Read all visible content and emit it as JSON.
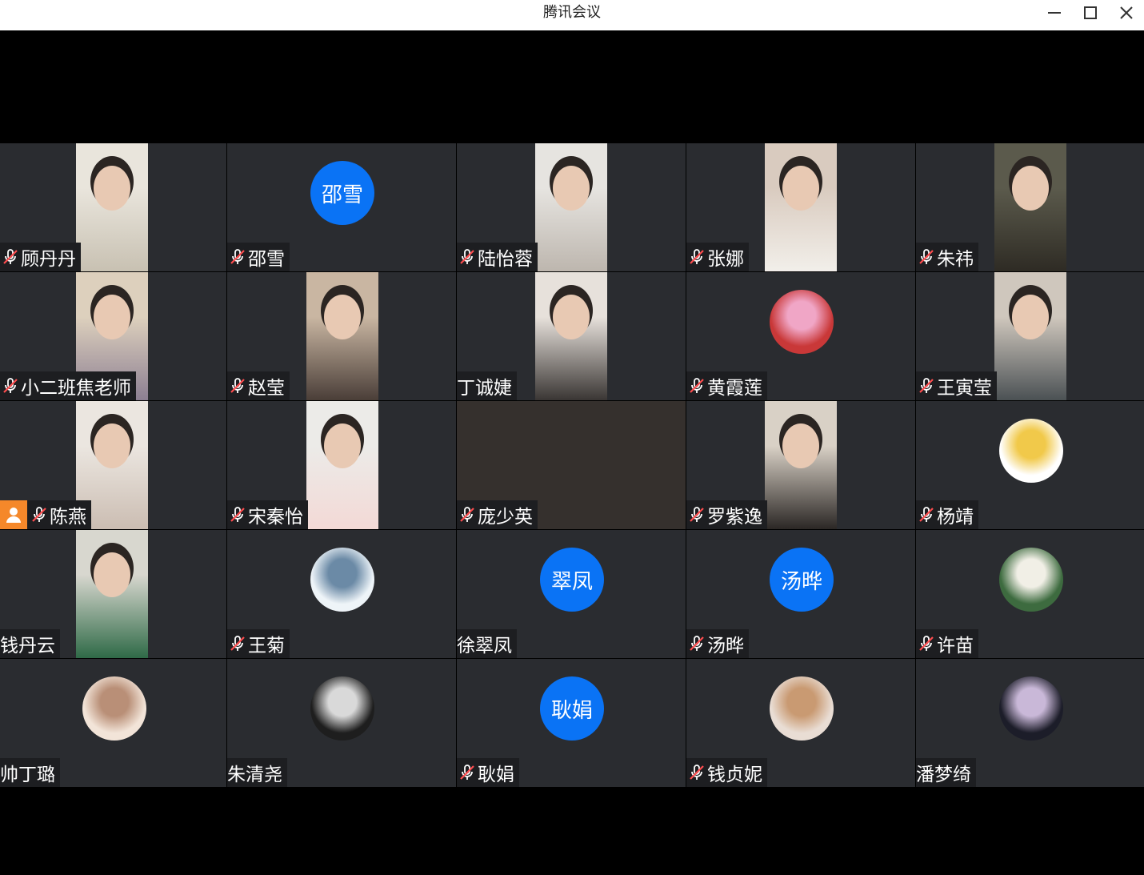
{
  "window": {
    "title": "腾讯会议"
  },
  "participants": [
    {
      "name": "顾丹丹",
      "muted": true,
      "media": "video",
      "colors": [
        "#e9e5dc",
        "#c8c1b2"
      ]
    },
    {
      "name": "邵雪",
      "muted": true,
      "media": "initials",
      "initials": "邵雪"
    },
    {
      "name": "陆怡蓉",
      "muted": true,
      "media": "video",
      "colors": [
        "#e6e4e0",
        "#bdb6ae"
      ]
    },
    {
      "name": "张娜",
      "muted": true,
      "media": "video",
      "colors": [
        "#d9cbbf",
        "#f2efea"
      ]
    },
    {
      "name": "朱祎",
      "muted": true,
      "media": "video",
      "colors": [
        "#5b5a4c",
        "#2e2b24"
      ]
    },
    {
      "name": "小二班焦老师",
      "muted": true,
      "media": "video",
      "colors": [
        "#ddd0bd",
        "#8c7f92"
      ]
    },
    {
      "name": "赵莹",
      "muted": true,
      "media": "video",
      "colors": [
        "#c9b6a2",
        "#4a3e38"
      ]
    },
    {
      "name": "丁诚婕",
      "muted": false,
      "media": "video",
      "colors": [
        "#e7e1db",
        "#3a3634"
      ]
    },
    {
      "name": "黄霞莲",
      "muted": true,
      "media": "avatar",
      "colors": [
        "#c93838",
        "#f0a6c6"
      ]
    },
    {
      "name": "王寅莹",
      "muted": true,
      "media": "video",
      "colors": [
        "#cfc7bd",
        "#4b5154"
      ]
    },
    {
      "name": "陈燕",
      "muted": true,
      "host": true,
      "media": "video",
      "colors": [
        "#ebe6e0",
        "#cbbdb2"
      ]
    },
    {
      "name": "宋秦怡",
      "muted": true,
      "media": "video",
      "colors": [
        "#ecebe8",
        "#f3d9d6"
      ]
    },
    {
      "name": "庞少英",
      "muted": true,
      "media": "none"
    },
    {
      "name": "罗紫逸",
      "muted": true,
      "media": "video",
      "colors": [
        "#d9d1c6",
        "#2b2725"
      ]
    },
    {
      "name": "杨靖",
      "muted": true,
      "media": "avatar",
      "colors": [
        "#ffffff",
        "#f1c94a"
      ]
    },
    {
      "name": "钱丹云",
      "muted": false,
      "media": "video",
      "colors": [
        "#d8d7cf",
        "#2f6a47"
      ]
    },
    {
      "name": "王菊",
      "muted": true,
      "media": "avatar",
      "colors": [
        "#eef4f8",
        "#6b8aa6"
      ]
    },
    {
      "name": "徐翠凤",
      "muted": false,
      "media": "initials",
      "initials": "翠凤"
    },
    {
      "name": "汤晔",
      "muted": true,
      "media": "initials",
      "initials": "汤晔"
    },
    {
      "name": "许苗",
      "muted": true,
      "media": "avatar",
      "colors": [
        "#3d6b3f",
        "#f1efe6"
      ]
    },
    {
      "name": "帅丁璐",
      "muted": false,
      "media": "avatar",
      "colors": [
        "#f2e4d8",
        "#b98f77"
      ]
    },
    {
      "name": "朱清尧",
      "muted": false,
      "media": "avatar",
      "colors": [
        "#1e1e1e",
        "#d9d9d9"
      ]
    },
    {
      "name": "耿娟",
      "muted": true,
      "media": "initials",
      "initials": "耿娟"
    },
    {
      "name": "钱贞妮",
      "muted": true,
      "media": "avatar",
      "colors": [
        "#e9ddd4",
        "#c99a72"
      ]
    },
    {
      "name": "潘梦绮",
      "muted": false,
      "media": "avatar",
      "colors": [
        "#1c1d29",
        "#c9b8d8"
      ]
    }
  ]
}
